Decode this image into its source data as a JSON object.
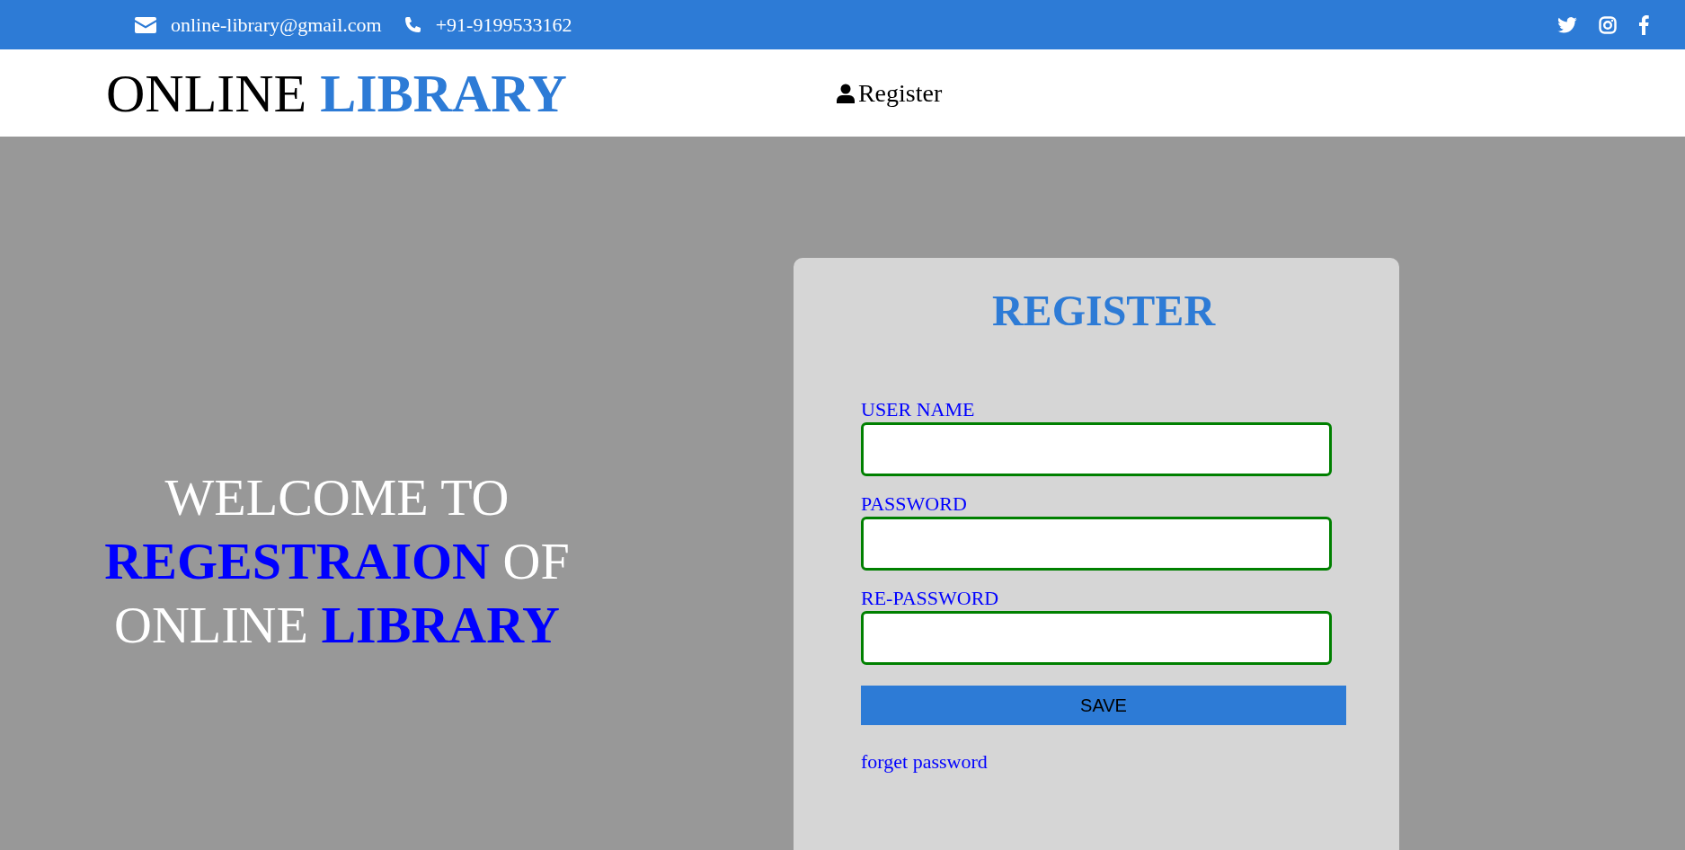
{
  "topbar": {
    "email": "online-library@gmail.com",
    "phone": "+91-9199533162"
  },
  "header": {
    "logo": "ONLINE **LIBRARY**",
    "nav": [
      {
        "label": "Register"
      }
    ]
  },
  "hero": {
    "welcome": "WELCOME TO **REGESTRAION** OF ONLINE **LIBRARY**"
  },
  "form": {
    "title": "REGISTER",
    "fields": [
      {
        "label": "USER NAME"
      },
      {
        "label": "PASSWORD"
      },
      {
        "label": "RE-PASSWORD"
      }
    ],
    "submit": "SAVE",
    "link": "forget password"
  }
}
